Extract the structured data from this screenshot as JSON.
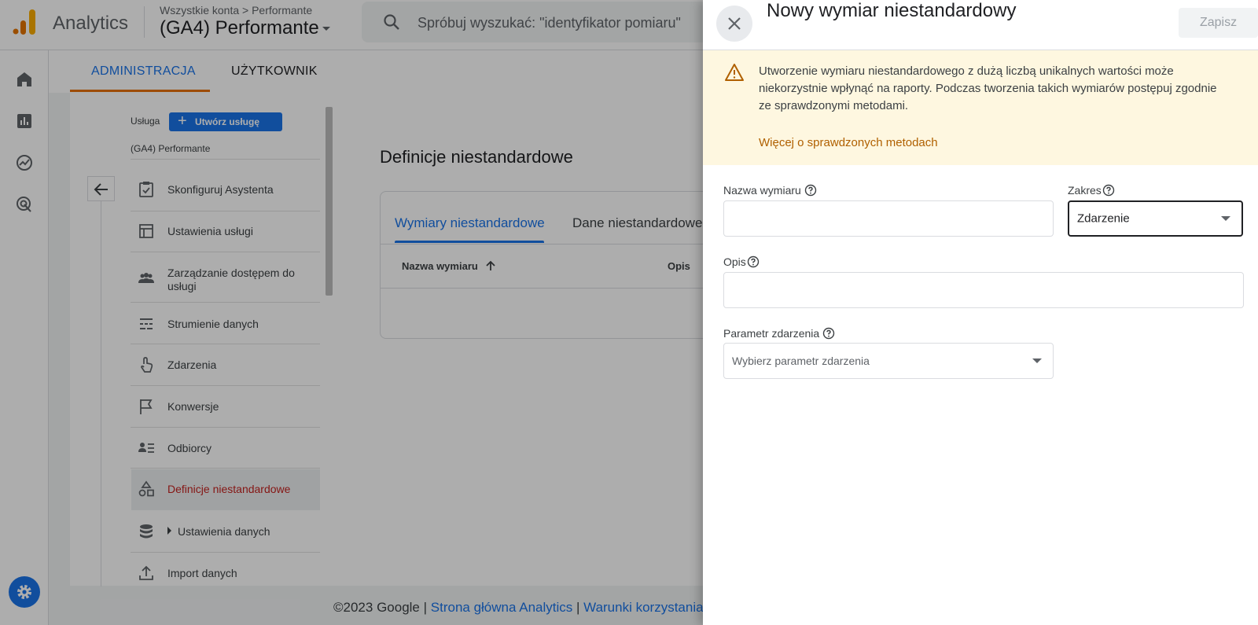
{
  "app": {
    "name": "Analytics",
    "breadcrumb": "Wszystkie konta > Performante",
    "property": "(GA4) Performante",
    "search_placeholder": "Spróbuj wyszukać: \"identyfikator pomiaru\""
  },
  "admin_tabs": [
    "ADMINISTRACJA",
    "UŻYTKOWNIK"
  ],
  "property_panel": {
    "label": "Usługa",
    "create_button": "Utwórz usługę",
    "property_name": "(GA4) Performante"
  },
  "menu": [
    {
      "label": "Skonfiguruj Asystenta",
      "icon": "checklist-icon"
    },
    {
      "label": "Ustawienia usługi",
      "icon": "layout-icon"
    },
    {
      "label": "Zarządzanie dostępem do usługi",
      "icon": "people-icon"
    },
    {
      "label": "Strumienie danych",
      "icon": "streams-icon"
    },
    {
      "label": "Zdarzenia",
      "icon": "touch-icon"
    },
    {
      "label": "Konwersje",
      "icon": "flag-icon"
    },
    {
      "label": "Odbiorcy",
      "icon": "audience-icon"
    },
    {
      "label": "Definicje niestandardowe",
      "icon": "shapes-icon",
      "active": true
    },
    {
      "label": "Ustawienia danych",
      "icon": "database-icon"
    },
    {
      "label": "Import danych",
      "icon": "upload-icon"
    }
  ],
  "custom_definitions": {
    "title": "Definicje niestandardowe",
    "tabs": [
      "Wymiary niestandardowe",
      "Dane niestandardowe"
    ],
    "columns": [
      "Nazwa wymiaru",
      "Opis"
    ]
  },
  "footer": {
    "copyright": "©2023 Google |",
    "link1": "Strona główna Analytics",
    "sep": "|",
    "link2": "Warunki korzystania"
  },
  "drawer": {
    "title": "Nowy wymiar niestandardowy",
    "save": "Zapisz",
    "warning_text": "Utworzenie wymiaru niestandardowego z dużą liczbą unikalnych wartości może niekorzystnie wpłynąć na raporty. Podczas tworzenia takich wymiarów postępuj zgodnie ze sprawdzonymi metodami.",
    "warning_link": "Więcej o sprawdzonych metodach",
    "fields": {
      "name_label": "Nazwa wymiaru",
      "name_value": "",
      "scope_label": "Zakres",
      "scope_value": "Zdarzenie",
      "desc_label": "Opis",
      "desc_value": "",
      "param_label": "Parametr zdarzenia",
      "param_placeholder": "Wybierz parametr zdarzenia"
    }
  },
  "colors": {
    "accent": "#1a73e8",
    "active_menu": "#c5221f",
    "tab_underline": "#e8710a",
    "warning_bg": "#fef7e0",
    "warning_link": "#b06000",
    "logo_orange": "#f9ab00",
    "logo_dark_orange": "#e37400"
  }
}
